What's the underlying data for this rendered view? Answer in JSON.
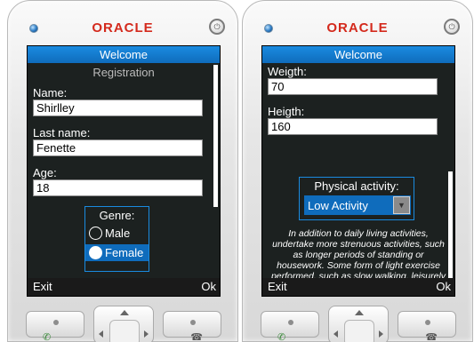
{
  "brand": "ORACLE",
  "left_screen": {
    "title": "Welcome",
    "subtitle": "Registration",
    "name_label": "Name:",
    "name_value": "Shirlley",
    "lastname_label": "Last name:",
    "lastname_value": "Fenette",
    "age_label": "Age:",
    "age_value": "18",
    "genre_label": "Genre:",
    "genre_options": [
      "Male",
      "Female"
    ],
    "genre_selected": "Female",
    "softkey_left": "Exit",
    "softkey_right": "Ok"
  },
  "right_screen": {
    "title": "Welcome",
    "weight_label": "Weigth:",
    "weight_value": "70",
    "height_label": "Heigth:",
    "height_value": "160",
    "activity_label": "Physical activity:",
    "activity_value": "Low Activity",
    "help_text": "In addition to daily living activities, undertake more strenuous activities, such as longer periods of standing or housework. Some form of light exercise performed, such as slow walking, leisurely bicycling or gardening.",
    "softkey_left": "Exit",
    "softkey_right": "Ok"
  },
  "colors": {
    "accent": "#0f6cbc",
    "screen_bg": "#1c2120",
    "brand": "#d42a1d"
  }
}
